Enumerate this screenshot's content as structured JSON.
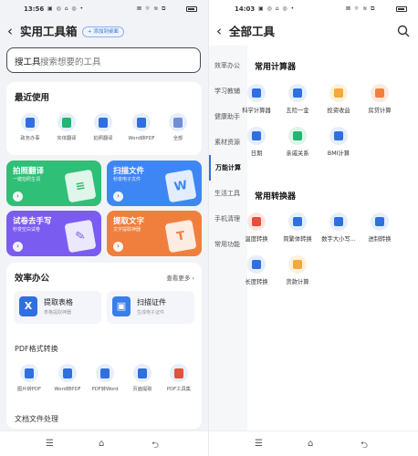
{
  "left": {
    "status": {
      "time": "13:56",
      "icons_left": "▣ ◎ ⌂ ◎ •",
      "icons_right": "⊠ ☼ ≋ ⧉"
    },
    "title": "实用工具箱",
    "pill": "+ 添加到桌面",
    "search": {
      "keyword": "搜工具",
      "placeholder": "搜索想要的工具"
    },
    "recent": {
      "title": "最近使用",
      "items": [
        {
          "label": "政务办事",
          "color": "#2f6fe0"
        },
        {
          "label": "实体翻译",
          "color": "#22b573"
        },
        {
          "label": "拍照翻译",
          "color": "#2f6fe0"
        },
        {
          "label": "Word转PDF",
          "color": "#2f6fe0"
        },
        {
          "label": "全部",
          "color": "#6e8fd8"
        }
      ]
    },
    "tiles": [
      {
        "title": "拍照翻译",
        "sub": "一键拍照生词",
        "color": "#2fbf77",
        "deco": "≡"
      },
      {
        "title": "扫描文件",
        "sub": "秒变电子文件",
        "color": "#3f86f5",
        "deco": "W"
      },
      {
        "title": "试卷去手写",
        "sub": "秒变空白试卷",
        "color": "#7b5cf0",
        "deco": "✎"
      },
      {
        "title": "提取文字",
        "sub": "文字提取神器",
        "color": "#f07f3e",
        "deco": "T"
      }
    ],
    "efficiency": {
      "title": "效率办公",
      "more": "查看更多 ›",
      "items": [
        {
          "title": "提取表格",
          "sub": "表格提取神器",
          "icon": "X",
          "color": "#2f6fe0"
        },
        {
          "title": "扫描证件",
          "sub": "生成电子证件",
          "icon": "▣",
          "color": "#3a7ee8"
        }
      ]
    },
    "pdf": {
      "title": "PDF格式转换",
      "items": [
        {
          "label": "图片转PDF",
          "color": "#2f6fe0"
        },
        {
          "label": "Word转PDF",
          "color": "#2f6fe0"
        },
        {
          "label": "PDF转Word",
          "color": "#2f6fe0"
        },
        {
          "label": "页面提取",
          "color": "#2f6fe0"
        },
        {
          "label": "PDF工具集",
          "color": "#e0523a"
        }
      ]
    },
    "doc_title": "文档文件处理",
    "nav": [
      "☰",
      "⌂",
      "⮌"
    ]
  },
  "right": {
    "status": {
      "time": "14:03",
      "icons_left": "▣ ◎ ⌂ ◎ •",
      "icons_right": "⊠ ☼ ≋ ⧉"
    },
    "title": "全部工具",
    "search_icon": "search-icon",
    "sidebar": [
      "效率办公",
      "学习教辅",
      "健康助手",
      "素材资源",
      "万能计算",
      "生活工具",
      "手机清理",
      "常用功能"
    ],
    "active_index": 4,
    "calc": {
      "title": "常用计算器",
      "items": [
        {
          "label": "科学计算器",
          "color": "#2f6fe0",
          "bg": "#e5eefc"
        },
        {
          "label": "五险一金",
          "color": "#2f6fe0",
          "bg": "#e5eefc"
        },
        {
          "label": "投资收益",
          "color": "#f3a93b",
          "bg": "#fdf1dd"
        },
        {
          "label": "房贷计算",
          "color": "#f07f3e",
          "bg": "#fde9dc"
        },
        {
          "label": "日期",
          "color": "#2f6fe0",
          "bg": "#e5eefc"
        },
        {
          "label": "亲戚关系",
          "color": "#22b573",
          "bg": "#e0f5ea"
        },
        {
          "label": "BMI计算",
          "color": "#2f6fe0",
          "bg": "#e5eefc"
        }
      ]
    },
    "conv": {
      "title": "常用转换器",
      "items": [
        {
          "label": "温度转换",
          "color": "#e0523a",
          "bg": "#fce6e2"
        },
        {
          "label": "简繁体转换",
          "color": "#2f6fe0",
          "bg": "#e5eefc"
        },
        {
          "label": "数字大小写...",
          "color": "#2f6fe0",
          "bg": "#e5eefc"
        },
        {
          "label": "进制转换",
          "color": "#2f6fe0",
          "bg": "#e5eefc"
        },
        {
          "label": "长度转换",
          "color": "#2f6fe0",
          "bg": "#e5eefc"
        },
        {
          "label": "货款计算",
          "color": "#f3a93b",
          "bg": "#fdf1dd"
        }
      ]
    },
    "nav": [
      "☰",
      "⌂",
      "⮌"
    ]
  }
}
